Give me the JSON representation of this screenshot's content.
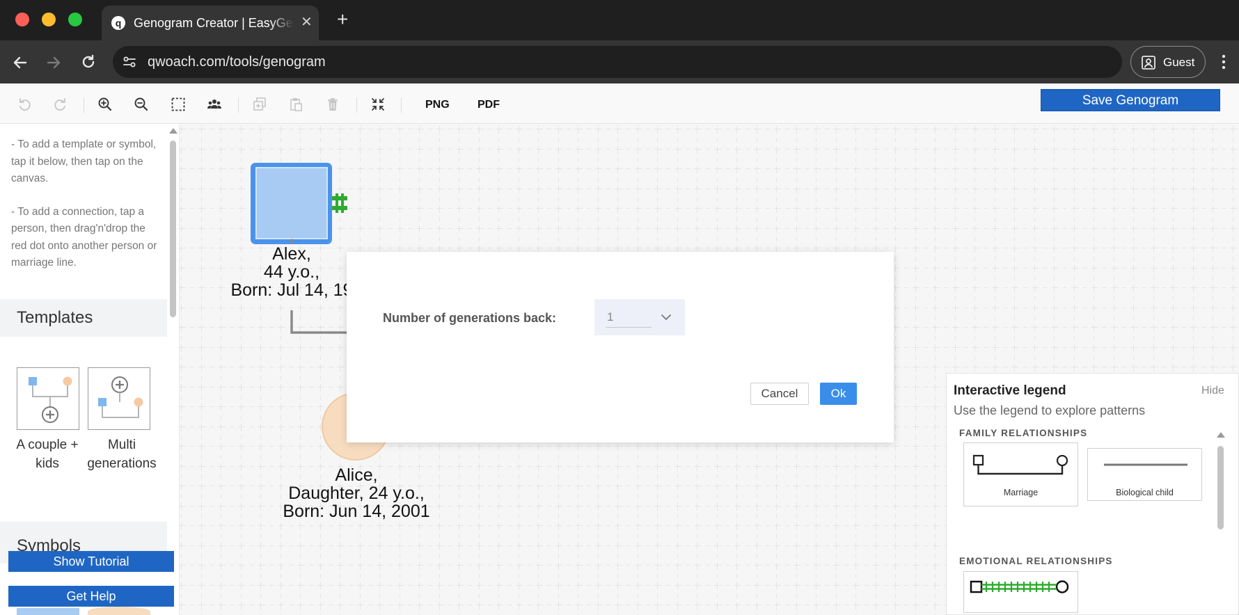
{
  "browser": {
    "tab_title": "Genogram Creator | EasyGenogram",
    "tab_favicon": "q",
    "url": "qwoach.com/tools/genogram",
    "profile_label": "Guest"
  },
  "toolbar": {
    "png_label": "PNG",
    "pdf_label": "PDF",
    "save_label": "Save Genogram"
  },
  "sidebar": {
    "help_add_template": "- To add a template or symbol, tap it below, then tap on the canvas.",
    "help_add_connection": "- To add a connection, tap a person, then drag'n'drop the red dot onto another person or marriage line.",
    "templates_heading": "Templates",
    "templates": [
      {
        "label": "A couple + kids"
      },
      {
        "label": "Multi generations"
      }
    ],
    "symbols_heading": "Symbols",
    "show_tutorial_label": "Show Tutorial",
    "get_help_label": "Get Help"
  },
  "canvas": {
    "people": [
      {
        "name": "Alex,",
        "line2": "44 y.o.,",
        "line3": "Born: Jul 14, 19"
      },
      {
        "name": "Alice,",
        "line2": "Daughter, 24 y.o.,",
        "line3": "Born: Jun 14, 2001"
      }
    ]
  },
  "dialog": {
    "label": "Number of generations back:",
    "selected_value": "1",
    "cancel_label": "Cancel",
    "ok_label": "Ok"
  },
  "legend": {
    "title": "Interactive legend",
    "hide_label": "Hide",
    "subtitle": "Use the legend to explore patterns",
    "family_heading": "FAMILY RELATIONSHIPS",
    "family_items": [
      {
        "label": "Marriage"
      },
      {
        "label": "Biological child"
      }
    ],
    "emotional_heading": "EMOTIONAL RELATIONSHIPS"
  },
  "colors": {
    "primary_button": "#1f66c4",
    "ok_button": "#3a8eea",
    "selected_person_fill": "#a7cbf2",
    "selected_person_border": "#3d8ee8",
    "female_fill": "#f7dcc0",
    "condition_quadrant": "#8b1aa0",
    "connection_handle": "#2eaa2e"
  }
}
